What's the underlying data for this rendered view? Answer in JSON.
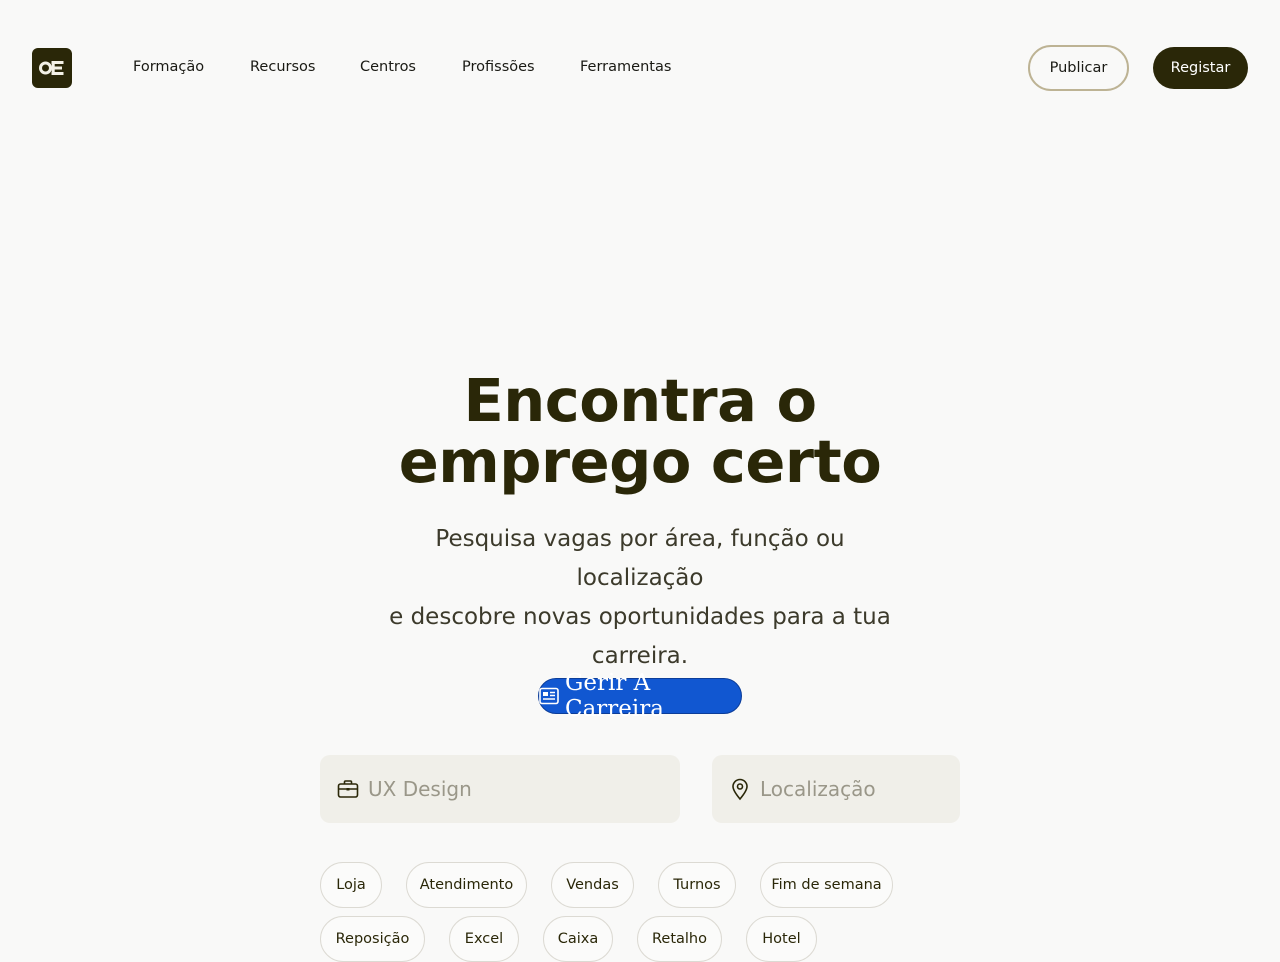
{
  "brand": {
    "logo_text": "OE",
    "logo_icon": "oe-logo-icon"
  },
  "nav": {
    "items": [
      {
        "label": "Formação"
      },
      {
        "label": "Recursos"
      },
      {
        "label": "Centros"
      },
      {
        "label": "Profissões"
      },
      {
        "label": "Ferramentas"
      }
    ]
  },
  "header_actions": {
    "publish_label": "Publicar",
    "register_label": "Registar"
  },
  "hero": {
    "title_line1": "Encontra o",
    "title_line2": "emprego certo",
    "subtitle_lines": [
      "Pesquisa vagas por área, função ou",
      "localização",
      "e descobre novas oportunidades para a tua",
      "carreira."
    ],
    "badge_label": "Gerir A Carreira",
    "badge_icon": "newspaper-icon"
  },
  "search": {
    "job_placeholder": "UX Design",
    "job_icon": "briefcase-icon",
    "location_placeholder": "Localização",
    "location_icon": "map-pin-icon"
  },
  "chips": {
    "row1": [
      "Loja",
      "Atendimento",
      "Vendas",
      "Turnos",
      "Fim de semana"
    ],
    "row2": [
      "Reposição",
      "Excel",
      "Caixa",
      "Retalho",
      "Hotel"
    ]
  },
  "colors": {
    "background": "#f9f9f8",
    "primary_dark": "#2a2708",
    "accent_blue": "#1157d1",
    "field_bg": "#f0efe9",
    "outline_gold": "#bdb394"
  }
}
